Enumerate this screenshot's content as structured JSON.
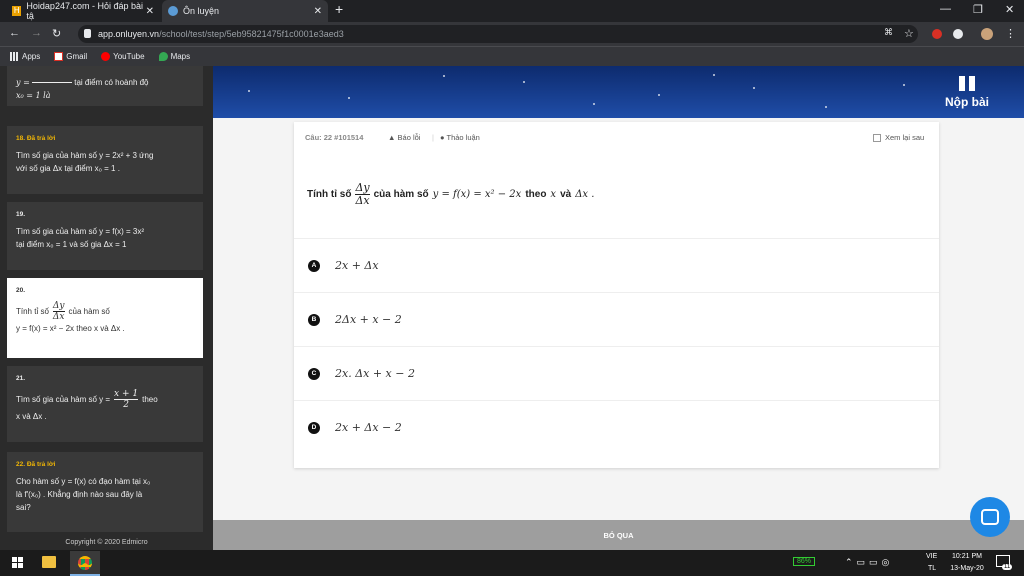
{
  "tabs": [
    {
      "title": "Hoidap247.com - Hỏi đáp bài tậ",
      "icon": "hoidap-favicon-icon"
    },
    {
      "title": "Ôn luyện",
      "icon": "onluyen-favicon-icon"
    }
  ],
  "omnibox": {
    "domain": "app.onluyen.vn",
    "path": "/school/test/step/5eb95821475f1c0001e3aed3"
  },
  "bookmarks": [
    "Apps",
    "Gmail",
    "YouTube",
    "Maps"
  ],
  "sidebar": {
    "partial_top": {
      "text": "tại điểm có hoành độ",
      "line2": "x₀ = 1 là"
    },
    "items": [
      {
        "num": "18.",
        "status": "Đã trả lời",
        "line1": "Tìm số gia của hàm số y = 2x² + 3 ứng",
        "line2": "với số gia Δx tại điểm x₀ = 1 ."
      },
      {
        "num": "19.",
        "status": "",
        "line1": "Tìm số gia của hàm số y = f(x) = 3x²",
        "line2": "tại điểm x₀ = 1 và số gia Δx = 1"
      },
      {
        "num": "20.",
        "status": "",
        "line1": "Tính tỉ số",
        "frac_num": "Δy",
        "frac_den": "Δx",
        "line1b": "của hàm số",
        "line2": "y = f(x) = x² − 2x theo x và Δx ."
      },
      {
        "num": "21.",
        "status": "",
        "line1": "Tìm số gia của hàm số y =",
        "frac_num": "x + 1",
        "frac_den": "2",
        "line1b": "theo",
        "line2": "x và Δx ."
      },
      {
        "num": "22.",
        "status": "Đã trả lời",
        "line1": "Cho hàm số y = f(x) có đạo hàm tại x₀",
        "line2": "là f′(x₀) . Khẳng định nào sau đây là",
        "line3": "sai?"
      }
    ],
    "copyright": "Copyright © 2020 Edmicro"
  },
  "header": {
    "submit_label": "Nộp bài"
  },
  "question": {
    "meta": "Câu: 22 #101514",
    "report": "Báo lỗi",
    "discuss": "Thảo luận",
    "review_later": "Xem lại sau",
    "prefix": "Tính tỉ số",
    "frac_num": "Δy",
    "frac_den": "Δx",
    "middle": "của hàm số",
    "formula": "y = f(x) = x² − 2x",
    "suffix": "theo",
    "var1": "x",
    "and": "và",
    "var2": "Δx ."
  },
  "options": [
    {
      "letter": "A",
      "value": "2x + Δx"
    },
    {
      "letter": "B",
      "value": "2Δx + x − 2"
    },
    {
      "letter": "C",
      "value": "2x. Δx + x − 2"
    },
    {
      "letter": "D",
      "value": "2x + Δx − 2"
    }
  ],
  "skip_label": "BỎ QUA",
  "taskbar": {
    "battery": "86%",
    "lang1": "VIE",
    "lang2": "TL",
    "time": "10:21 PM",
    "date": "13-May-20",
    "notif_count": "11"
  }
}
